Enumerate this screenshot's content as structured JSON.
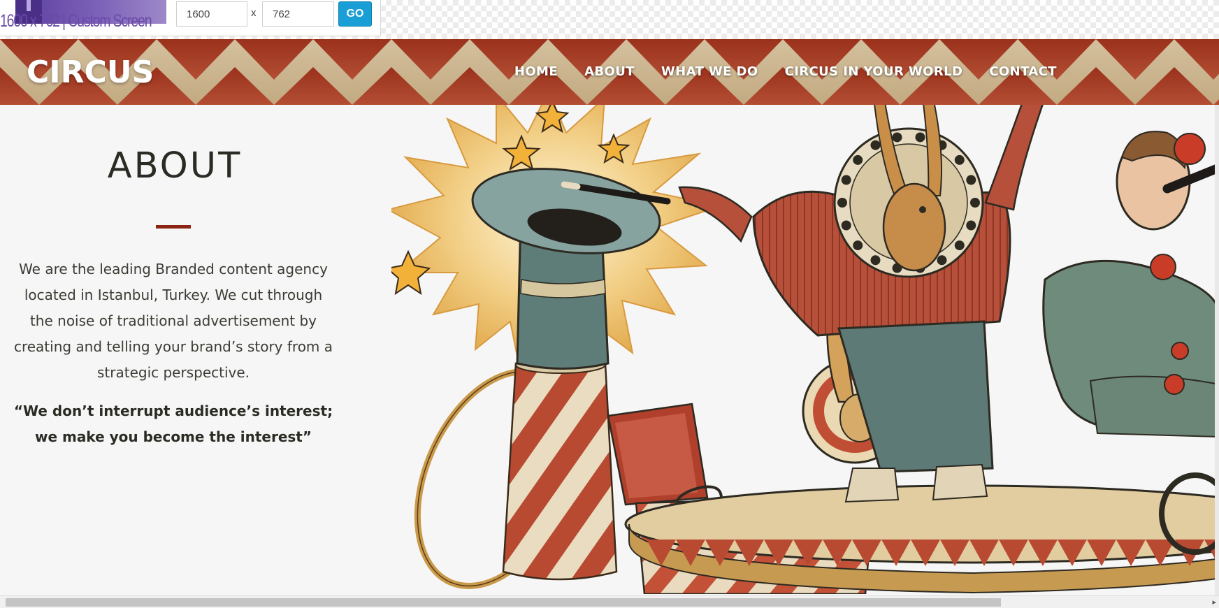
{
  "toolbar": {
    "size_label": "1600 x 762 | Custom Screen",
    "width_value": "1600",
    "height_value": "762",
    "separator": "x",
    "go_label": "GO"
  },
  "header": {
    "logo": "CIRCUS",
    "nav": [
      "HOME",
      "ABOUT",
      "WHAT WE DO",
      "CIRCUS IN YOUR WORLD",
      "CONTACT"
    ]
  },
  "about": {
    "title": "ABOUT",
    "body": "We are the leading Branded content agency located in Istanbul, Turkey. We cut through the noise of traditional advertisement by creating and telling your brand’s story from a strategic perspective.",
    "quote": "“We don’t interrupt audience’s interest; we make you become the interest”"
  },
  "colors": {
    "header_red": "#b8472c",
    "header_cream": "#e2cfa6",
    "accent_divider": "#8b2412",
    "go_button": "#1a9ed6",
    "size_badge": "#6a4aa8"
  },
  "icons": {
    "scroll_right": "chevron-right-icon"
  },
  "scroll_right_glyph": "▸"
}
